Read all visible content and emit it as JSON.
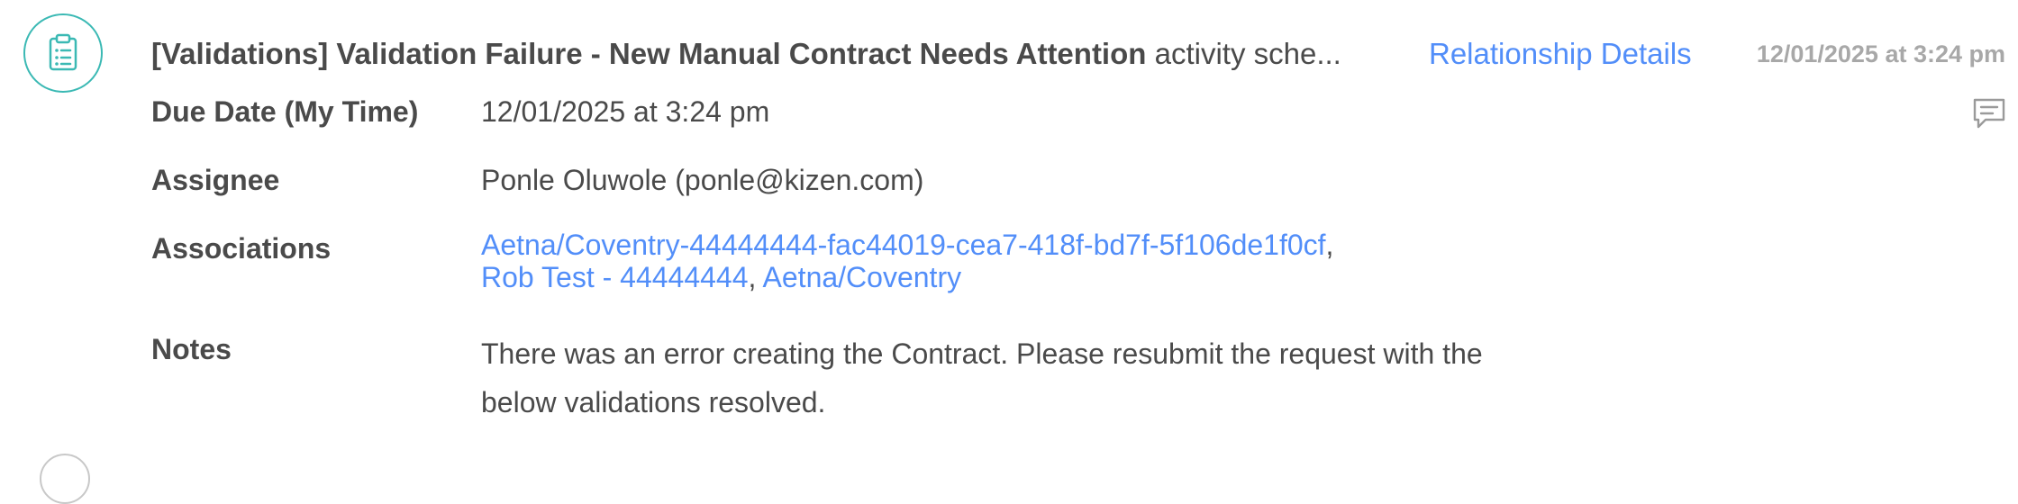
{
  "activity": {
    "title": "[Validations] Validation Failure - New Manual Contract Needs Attention",
    "title_suffix": "activity sche...",
    "relationship_link": "Relationship Details",
    "timestamp": "12/01/2025 at 3:24 pm",
    "icon": "clipboard-list-icon",
    "comment_icon": "comment-icon",
    "accent_color": "#3bb9b4",
    "link_color": "#528ef9"
  },
  "fields": {
    "due_date": {
      "label": "Due Date (My Time)",
      "value": "12/01/2025 at 3:24 pm"
    },
    "assignee": {
      "label": "Assignee",
      "value": "Ponle Oluwole (ponle@kizen.com)"
    },
    "associations": {
      "label": "Associations",
      "items": [
        "Aetna/Coventry-44444444-fac44019-cea7-418f-bd7f-5f106de1f0cf",
        "Rob Test - 44444444",
        "Aetna/Coventry"
      ],
      "separator": ","
    },
    "notes": {
      "label": "Notes",
      "value": "There was an error creating the Contract. Please resubmit the request with the below validations resolved."
    }
  }
}
